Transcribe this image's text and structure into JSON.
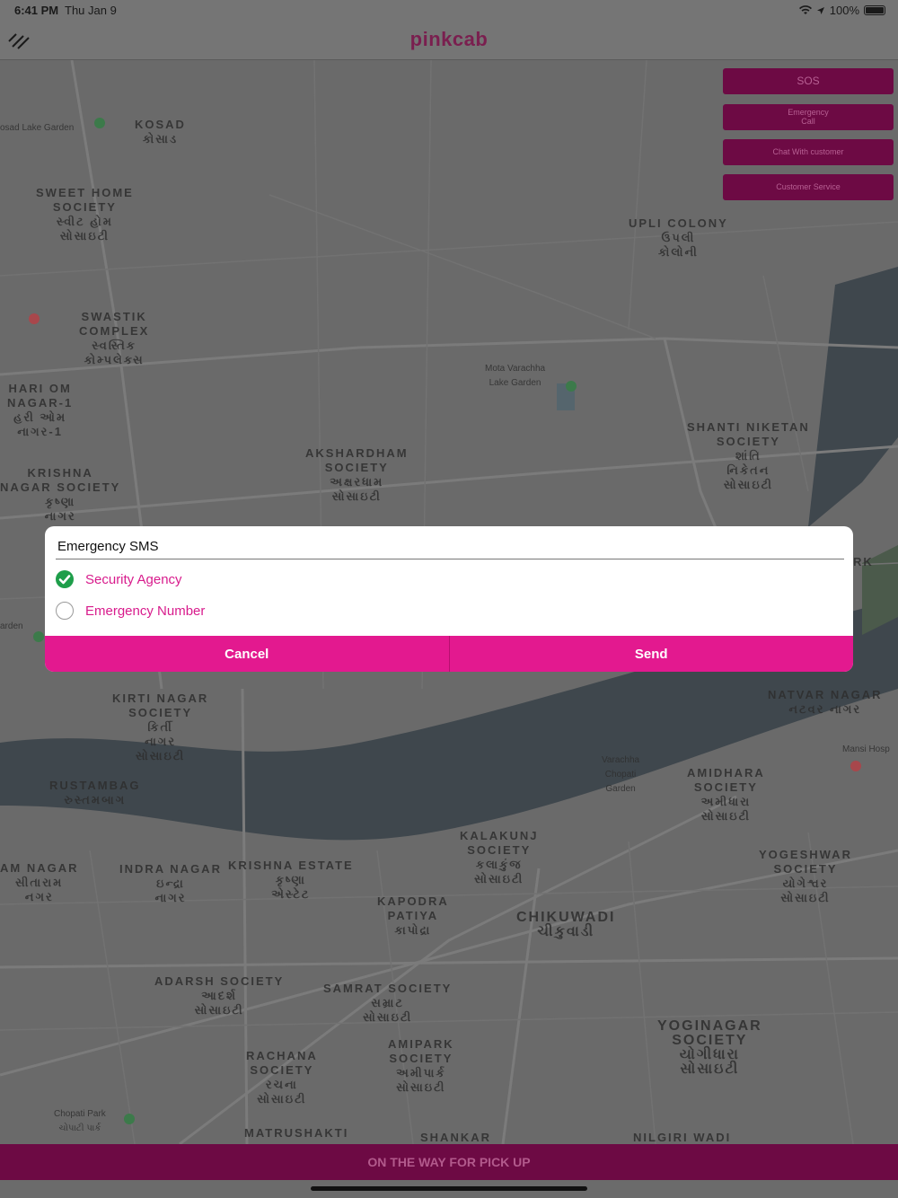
{
  "status_bar": {
    "time": "6:41 PM",
    "date": "Thu Jan 9",
    "battery": "100%"
  },
  "header": {
    "app_name": "pinkcab",
    "menu_icon": "menu-icon"
  },
  "actions": {
    "sos": "SOS",
    "emergency_call": "Emergency\nCall",
    "chat_customer": "Chat With customer",
    "customer_service": "Customer Service"
  },
  "map": {
    "labels": [
      "KOSAD",
      "કોસાડ",
      "SWEET HOME",
      "SOCIETY",
      "સ્વીટ હોમ",
      "સોસાઇટી",
      "SWASTIK",
      "COMPLEX",
      "સ્વસ્તિક",
      "કોમ્પલેક્સ",
      "HARI OM",
      "NAGAR-1",
      "હરી ઓમ",
      "નાગર-1",
      "KRISHNA",
      "NAGAR SOCIETY",
      "કૃષ્ણા",
      "નાગર",
      "UPLI COLONY",
      "ઉપલી",
      "કોલોની",
      "AKSHARDHAM",
      "SOCIETY",
      "અક્ષરધામ",
      "સોસાઇટી",
      "SHANTI NIKETAN",
      "SOCIETY",
      "શાંતિ",
      "નિકેતન",
      "સોસાઇટી",
      "Mota Varachha",
      "Lake Garden",
      "osad Lake Garden",
      "KIRTI NAGAR",
      "SOCIETY",
      "કિર્તી",
      "નાગર",
      "સોસાઇટી",
      "RUSTAMBAG",
      "રુસ્તમબાગ",
      "NATVAR NAGAR",
      "નટવર નાગર",
      "Mansi Hosp",
      "AMIDHARA",
      "SOCIETY",
      "અમીધારા",
      "સોસાઇટી",
      "Varachha",
      "Chopati",
      "Garden",
      "KALAKUNJ",
      "SOCIETY",
      "કલાકુંજ",
      "સોસાઇટી",
      "YOGESHWAR",
      "SOCIETY",
      "યોગેશ્વર",
      "સોસાઇટી",
      "AM NAGAR",
      "સીતારામ",
      "નગર",
      "INDRA NAGAR",
      "ઇન્દ્રા",
      "નાગર",
      "KRISHNA ESTATE",
      "કૃષ્ણા",
      "એસ્ટેટ",
      "KAPODRA",
      "PATIYA",
      "કાપોદ્રા",
      "CHIKUWADI",
      "ચીકુવાડી",
      "ADARSH SOCIETY",
      "આદર્શ",
      "સોસાઇટી",
      "SAMRAT SOCIETY",
      "સમ્રાટ",
      "સોસાઇટી",
      "RACHANA",
      "SOCIETY",
      "રચના",
      "સોસાઇટી",
      "AMIPARK",
      "SOCIETY",
      "અમીપાર્ક",
      "સોસાઇટી",
      "YOGINAGAR",
      "SOCIETY",
      "યોગીધારા",
      "સોસાઇટી",
      "Chopati Park",
      "ચોપાટી પાર્ક",
      "MATRUSHAKTI",
      "SHANKAR",
      "NILGIRI WADI",
      "RK",
      "arden"
    ]
  },
  "dialog": {
    "title": "Emergency SMS",
    "options": [
      {
        "label": "Security Agency",
        "checked": true
      },
      {
        "label": "Emergency Number",
        "checked": false
      }
    ],
    "cancel": "Cancel",
    "send": "Send"
  },
  "footer": {
    "status": "ON THE WAY FOR PICK UP"
  },
  "colors": {
    "accent": "#e3198f",
    "dim_accent": "#6d0a44",
    "check_green": "#1e9e4a"
  }
}
